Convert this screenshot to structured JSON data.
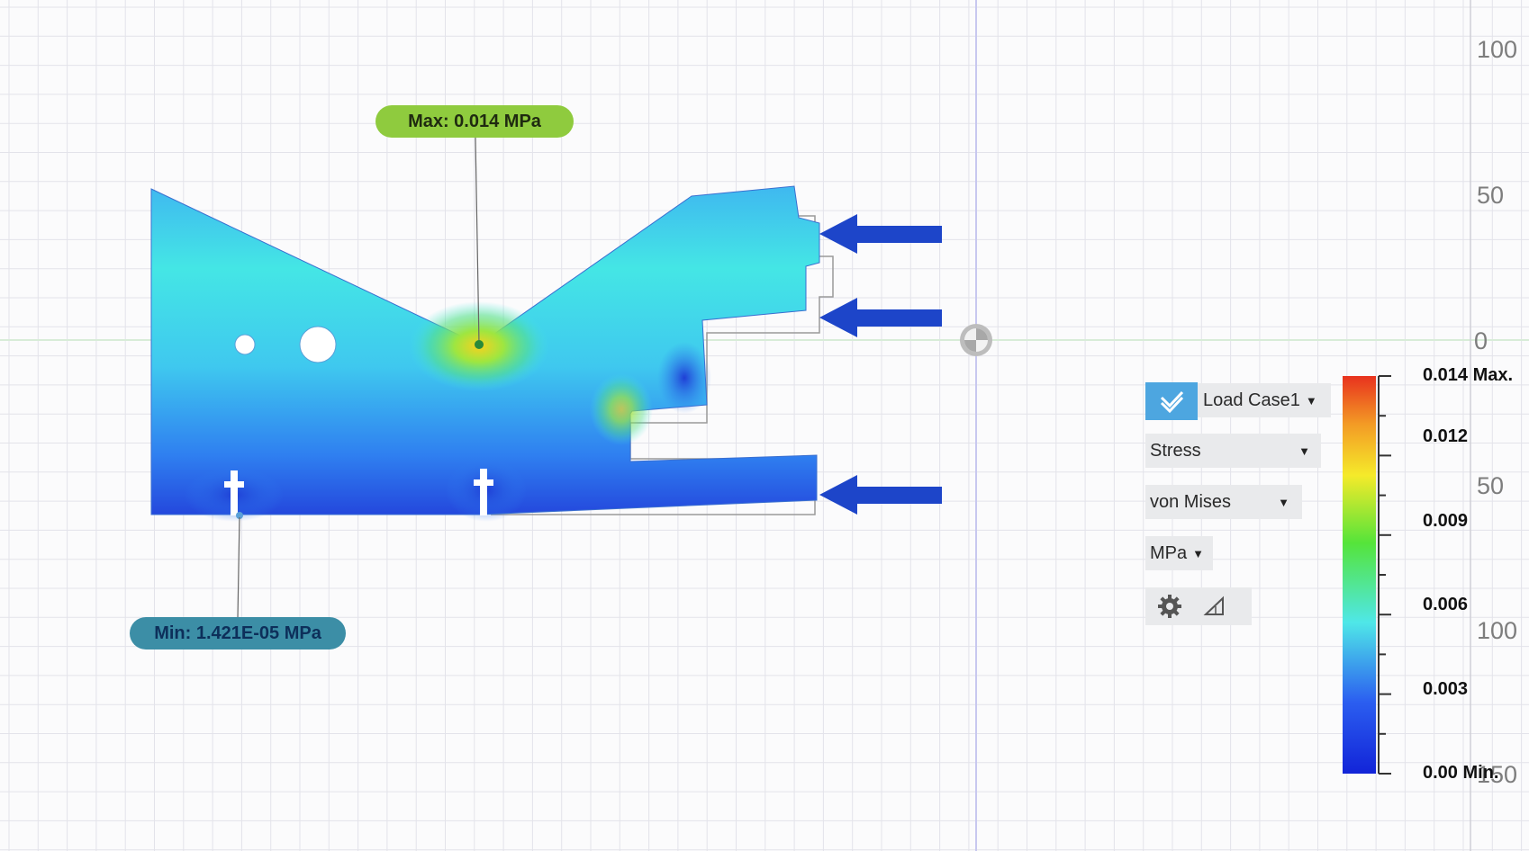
{
  "viewport": {
    "ruler_labels": [
      "100",
      "50",
      "0",
      "50",
      "100",
      "150"
    ],
    "grid_color": "#e3e3ea",
    "axis_colors": {
      "vertical": "#c8c8ef",
      "horizontal": "#d8ecd8"
    }
  },
  "annotations": {
    "max_label": "Max: 0.014 MPa",
    "min_label": "Min: 1.421E-05 MPa"
  },
  "model": {
    "load_arrows": 3,
    "arrow_color": "#1d45c9"
  },
  "results_panel": {
    "load_case": "Load Case1",
    "result_type": "Stress",
    "component": "von Mises",
    "units": "MPa",
    "icons": [
      "checkmark-icon",
      "gear-icon",
      "deformation-scale-icon"
    ]
  },
  "legend": {
    "max": "0.014 Max.",
    "ticks": [
      "0.012",
      "0.009",
      "0.006",
      "0.003"
    ],
    "min": "0.00 Min.",
    "colors": [
      "#e8321e",
      "#f5ea2a",
      "#55e43a",
      "#4fe7e8",
      "#2b5ef0",
      "#1224d8"
    ]
  }
}
